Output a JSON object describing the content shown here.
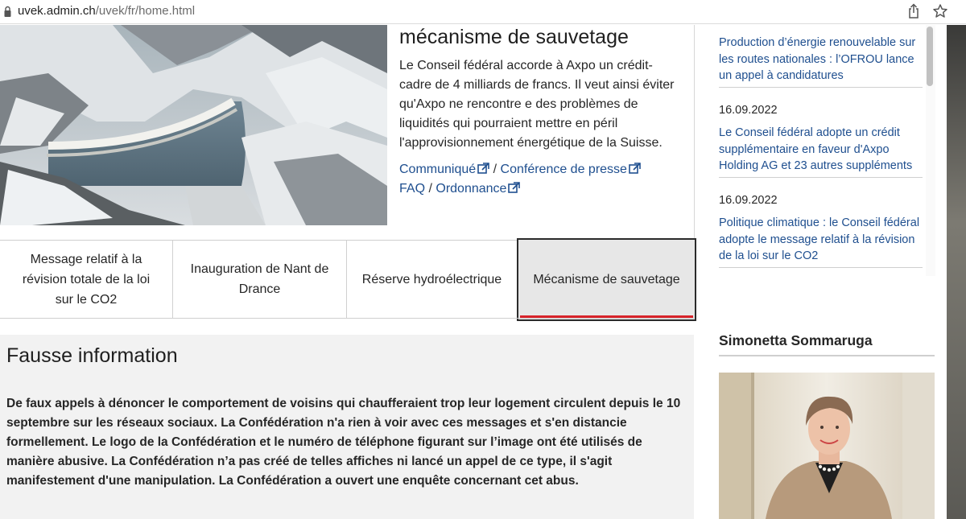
{
  "browser": {
    "url_host": "uvek.admin.ch",
    "url_path": "/uvek/fr/home.html"
  },
  "hero": {
    "title": "mécanisme de sauvetage",
    "text": "Le Conseil fédéral accorde à Axpo un crédit-cadre de 4 milliards de francs. Il veut ainsi éviter qu'Axpo ne rencontre e des problèmes de liquidités qui pourraient mettre en péril l'approvisionnement énergétique de la Suisse.",
    "links": {
      "communique": "Communiqué",
      "conference": "Conférence de presse",
      "faq": "FAQ",
      "ordonnance": "Ordonnance",
      "separator": "/"
    }
  },
  "news": [
    {
      "date": "",
      "title": "Production d’énergie renouvelable sur les routes nationales : l’OFROU lance un appel à candidatures"
    },
    {
      "date": "16.09.2022",
      "title": "Le Conseil fédéral adopte un crédit supplémentaire en faveur d'Axpo Holding AG et 23 autres suppléments"
    },
    {
      "date": "16.09.2022",
      "title": "Politique climatique : le Conseil fédéral adopte le message relatif à la révision de la loi sur le CO2"
    }
  ],
  "tabs": [
    {
      "label": "Message relatif à la révision totale de la loi sur le CO2"
    },
    {
      "label": "Inauguration de Nant de Drance"
    },
    {
      "label": "Réserve hydroélectrique"
    },
    {
      "label": "Mécanisme de sauvetage",
      "active": true
    }
  ],
  "notice": {
    "title": "Fausse information",
    "text": "De faux appels à dénoncer le comportement de voisins qui chaufferaient trop leur logement circulent depuis le 10 septembre sur les réseaux sociaux. La Confédération n'a rien à voir avec ces messages et s'en distancie formellement. Le logo de la Confédération et le numéro de téléphone figurant sur l’image ont été utilisés de manière abusive. La Confédération n’a pas créé de telles affiches ni lancé un appel de ce type, il s'agit manifestement d'une manipulation. La Confédération a ouvert une enquête concernant cet abus."
  },
  "profile": {
    "name": "Simonetta Sommaruga"
  },
  "colors": {
    "link": "#1f4f8f",
    "active_tab_underline": "#d8232a",
    "notice_background": "#f2f2f2"
  },
  "icons": [
    "lock-icon",
    "share-icon",
    "star-icon",
    "external-link-icon"
  ]
}
